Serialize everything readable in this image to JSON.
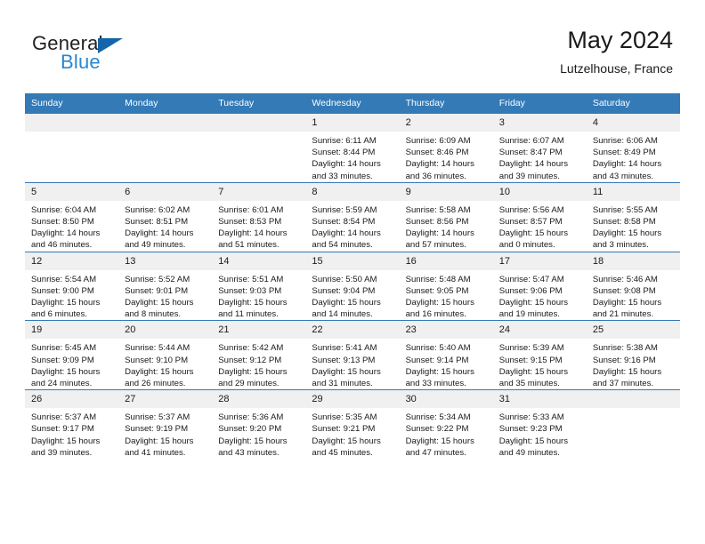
{
  "logo": {
    "word_top": "General",
    "word_bottom": "Blue",
    "triangle_color": "#1565a8",
    "blue_color": "#2787d4",
    "icon": "triangle-icon"
  },
  "header": {
    "title": "May 2024",
    "subtitle": "Lutzelhouse, France"
  },
  "theme": {
    "header_blue": "#337ab7",
    "daynum_bg": "#f0f0f0"
  },
  "weekdays": [
    "Sunday",
    "Monday",
    "Tuesday",
    "Wednesday",
    "Thursday",
    "Friday",
    "Saturday"
  ],
  "labels": {
    "sunrise": "Sunrise:",
    "sunset": "Sunset:",
    "daylight": "Daylight:"
  },
  "weeks": [
    [
      {
        "day": "",
        "empty": true
      },
      {
        "day": "",
        "empty": true
      },
      {
        "day": "",
        "empty": true
      },
      {
        "day": "1",
        "sunrise": "Sunrise: 6:11 AM",
        "sunset": "Sunset: 8:44 PM",
        "daylight_1": "Daylight: 14 hours",
        "daylight_2": "and 33 minutes."
      },
      {
        "day": "2",
        "sunrise": "Sunrise: 6:09 AM",
        "sunset": "Sunset: 8:46 PM",
        "daylight_1": "Daylight: 14 hours",
        "daylight_2": "and 36 minutes."
      },
      {
        "day": "3",
        "sunrise": "Sunrise: 6:07 AM",
        "sunset": "Sunset: 8:47 PM",
        "daylight_1": "Daylight: 14 hours",
        "daylight_2": "and 39 minutes."
      },
      {
        "day": "4",
        "sunrise": "Sunrise: 6:06 AM",
        "sunset": "Sunset: 8:49 PM",
        "daylight_1": "Daylight: 14 hours",
        "daylight_2": "and 43 minutes."
      }
    ],
    [
      {
        "day": "5",
        "sunrise": "Sunrise: 6:04 AM",
        "sunset": "Sunset: 8:50 PM",
        "daylight_1": "Daylight: 14 hours",
        "daylight_2": "and 46 minutes."
      },
      {
        "day": "6",
        "sunrise": "Sunrise: 6:02 AM",
        "sunset": "Sunset: 8:51 PM",
        "daylight_1": "Daylight: 14 hours",
        "daylight_2": "and 49 minutes."
      },
      {
        "day": "7",
        "sunrise": "Sunrise: 6:01 AM",
        "sunset": "Sunset: 8:53 PM",
        "daylight_1": "Daylight: 14 hours",
        "daylight_2": "and 51 minutes."
      },
      {
        "day": "8",
        "sunrise": "Sunrise: 5:59 AM",
        "sunset": "Sunset: 8:54 PM",
        "daylight_1": "Daylight: 14 hours",
        "daylight_2": "and 54 minutes."
      },
      {
        "day": "9",
        "sunrise": "Sunrise: 5:58 AM",
        "sunset": "Sunset: 8:56 PM",
        "daylight_1": "Daylight: 14 hours",
        "daylight_2": "and 57 minutes."
      },
      {
        "day": "10",
        "sunrise": "Sunrise: 5:56 AM",
        "sunset": "Sunset: 8:57 PM",
        "daylight_1": "Daylight: 15 hours",
        "daylight_2": "and 0 minutes."
      },
      {
        "day": "11",
        "sunrise": "Sunrise: 5:55 AM",
        "sunset": "Sunset: 8:58 PM",
        "daylight_1": "Daylight: 15 hours",
        "daylight_2": "and 3 minutes."
      }
    ],
    [
      {
        "day": "12",
        "sunrise": "Sunrise: 5:54 AM",
        "sunset": "Sunset: 9:00 PM",
        "daylight_1": "Daylight: 15 hours",
        "daylight_2": "and 6 minutes."
      },
      {
        "day": "13",
        "sunrise": "Sunrise: 5:52 AM",
        "sunset": "Sunset: 9:01 PM",
        "daylight_1": "Daylight: 15 hours",
        "daylight_2": "and 8 minutes."
      },
      {
        "day": "14",
        "sunrise": "Sunrise: 5:51 AM",
        "sunset": "Sunset: 9:03 PM",
        "daylight_1": "Daylight: 15 hours",
        "daylight_2": "and 11 minutes."
      },
      {
        "day": "15",
        "sunrise": "Sunrise: 5:50 AM",
        "sunset": "Sunset: 9:04 PM",
        "daylight_1": "Daylight: 15 hours",
        "daylight_2": "and 14 minutes."
      },
      {
        "day": "16",
        "sunrise": "Sunrise: 5:48 AM",
        "sunset": "Sunset: 9:05 PM",
        "daylight_1": "Daylight: 15 hours",
        "daylight_2": "and 16 minutes."
      },
      {
        "day": "17",
        "sunrise": "Sunrise: 5:47 AM",
        "sunset": "Sunset: 9:06 PM",
        "daylight_1": "Daylight: 15 hours",
        "daylight_2": "and 19 minutes."
      },
      {
        "day": "18",
        "sunrise": "Sunrise: 5:46 AM",
        "sunset": "Sunset: 9:08 PM",
        "daylight_1": "Daylight: 15 hours",
        "daylight_2": "and 21 minutes."
      }
    ],
    [
      {
        "day": "19",
        "sunrise": "Sunrise: 5:45 AM",
        "sunset": "Sunset: 9:09 PM",
        "daylight_1": "Daylight: 15 hours",
        "daylight_2": "and 24 minutes."
      },
      {
        "day": "20",
        "sunrise": "Sunrise: 5:44 AM",
        "sunset": "Sunset: 9:10 PM",
        "daylight_1": "Daylight: 15 hours",
        "daylight_2": "and 26 minutes."
      },
      {
        "day": "21",
        "sunrise": "Sunrise: 5:42 AM",
        "sunset": "Sunset: 9:12 PM",
        "daylight_1": "Daylight: 15 hours",
        "daylight_2": "and 29 minutes."
      },
      {
        "day": "22",
        "sunrise": "Sunrise: 5:41 AM",
        "sunset": "Sunset: 9:13 PM",
        "daylight_1": "Daylight: 15 hours",
        "daylight_2": "and 31 minutes."
      },
      {
        "day": "23",
        "sunrise": "Sunrise: 5:40 AM",
        "sunset": "Sunset: 9:14 PM",
        "daylight_1": "Daylight: 15 hours",
        "daylight_2": "and 33 minutes."
      },
      {
        "day": "24",
        "sunrise": "Sunrise: 5:39 AM",
        "sunset": "Sunset: 9:15 PM",
        "daylight_1": "Daylight: 15 hours",
        "daylight_2": "and 35 minutes."
      },
      {
        "day": "25",
        "sunrise": "Sunrise: 5:38 AM",
        "sunset": "Sunset: 9:16 PM",
        "daylight_1": "Daylight: 15 hours",
        "daylight_2": "and 37 minutes."
      }
    ],
    [
      {
        "day": "26",
        "sunrise": "Sunrise: 5:37 AM",
        "sunset": "Sunset: 9:17 PM",
        "daylight_1": "Daylight: 15 hours",
        "daylight_2": "and 39 minutes."
      },
      {
        "day": "27",
        "sunrise": "Sunrise: 5:37 AM",
        "sunset": "Sunset: 9:19 PM",
        "daylight_1": "Daylight: 15 hours",
        "daylight_2": "and 41 minutes."
      },
      {
        "day": "28",
        "sunrise": "Sunrise: 5:36 AM",
        "sunset": "Sunset: 9:20 PM",
        "daylight_1": "Daylight: 15 hours",
        "daylight_2": "and 43 minutes."
      },
      {
        "day": "29",
        "sunrise": "Sunrise: 5:35 AM",
        "sunset": "Sunset: 9:21 PM",
        "daylight_1": "Daylight: 15 hours",
        "daylight_2": "and 45 minutes."
      },
      {
        "day": "30",
        "sunrise": "Sunrise: 5:34 AM",
        "sunset": "Sunset: 9:22 PM",
        "daylight_1": "Daylight: 15 hours",
        "daylight_2": "and 47 minutes."
      },
      {
        "day": "31",
        "sunrise": "Sunrise: 5:33 AM",
        "sunset": "Sunset: 9:23 PM",
        "daylight_1": "Daylight: 15 hours",
        "daylight_2": "and 49 minutes."
      },
      {
        "day": "",
        "empty": true
      }
    ]
  ]
}
